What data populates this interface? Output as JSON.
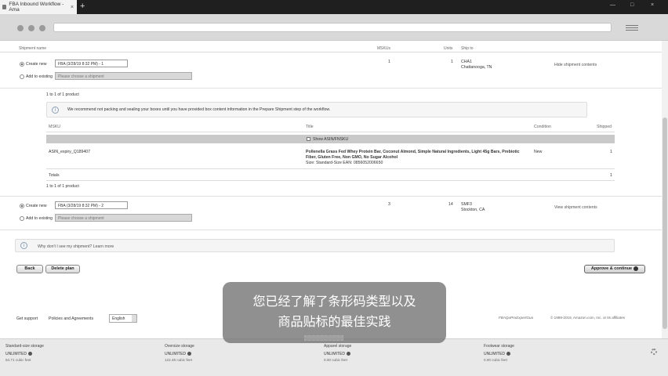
{
  "browser": {
    "tab_title": "FBA Inbound Workflow - Ama",
    "tab_close": "×",
    "new_tab": "+",
    "window_controls": [
      "—",
      "□",
      "×"
    ]
  },
  "table": {
    "headers": {
      "shipment_name": "Shipment name",
      "mskus": "MSKUs",
      "units": "Units",
      "ship_to": "Ship to"
    }
  },
  "shipments": [
    {
      "create_new_label": "Create new",
      "name_value": "FBA (3/28/19 8:32 PM) - 1",
      "add_existing_label": "Add to existing",
      "choose_placeholder": "Please choose a shipment",
      "mskus": "1",
      "units": "1",
      "ship_to_code": "CHA1",
      "ship_to_city": "Chattanooga, TN",
      "contents_link": "Hide shipment contents"
    },
    {
      "create_new_label": "Create new",
      "name_value": "FBA (3/28/19 8:32 PM) - 2",
      "add_existing_label": "Add to existing",
      "choose_placeholder": "Please choose a shipment",
      "mskus": "3",
      "units": "14",
      "ship_to_code": "SMF3",
      "ship_to_city": "Stockton, CA",
      "contents_link": "View shipment contents"
    }
  ],
  "detail": {
    "count_top": "1 to 1 of 1 product",
    "info_message": "We recommend not packing and sealing your boxes until you have provided box content information in the Prepare Shipment step of the workflow.",
    "headers": {
      "msku": "MSKU",
      "title": "Title",
      "condition": "Condition",
      "shipped": "Shipped"
    },
    "show_asin_label": "Show ASIN/FNSKU",
    "product": {
      "msku": "ASIN_expiry_Q189407",
      "title_line1": "Pollenella Grass Fed Whey Protein Bar, Coconut Almond, Simple Natural Ingredients, Light 45g Bars, Prebiotic",
      "title_line2": "Fiber, Gluten Free, Non GMO, No Sugar Alcohol",
      "title_line3": "Size: Standard-Size  EAN: 0856052006650",
      "condition": "New",
      "shipped": "1"
    },
    "totals_label": "Totals",
    "totals_value": "1",
    "count_bottom": "1 to 1 of 1 product"
  },
  "why_link": "Why don't I see my shipment? Learn more",
  "buttons": {
    "back": "Back",
    "delete_plan": "Delete plan",
    "approve": "Approve & continue"
  },
  "footer_links": {
    "get_support": "Get support",
    "policies": "Policies and Agreements",
    "language": "English",
    "copyright": "© 1999-2019, Amazon.com, Inc. or its affiliates",
    "watermark": "FBAQuProExpertGuo"
  },
  "storage": [
    {
      "title": "Standard-size storage",
      "value": "UNLIMITED",
      "cubic": "84.71 cubic feet"
    },
    {
      "title": "Oversize storage",
      "value": "UNLIMITED",
      "cubic": "122.48 cubic feet"
    },
    {
      "title": "Apparel storage",
      "value": "UNLIMITED",
      "cubic": "0.00 cubic feet"
    },
    {
      "title": "Footwear storage",
      "value": "UNLIMITED",
      "cubic": "0.00 cubic feet"
    }
  ],
  "subtitle": {
    "line1": "您已经了解了条形码类型以及",
    "line2": "商品贴标的最佳实践"
  },
  "icons": {
    "info": "info-icon",
    "settings": "gear-icon",
    "help": "question-icon"
  }
}
